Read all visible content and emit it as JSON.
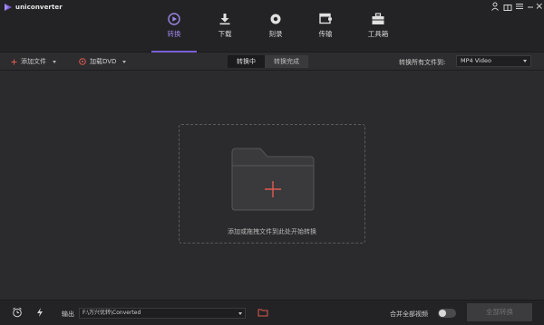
{
  "app": {
    "name": "uniconverter",
    "brand_color": "#7b5fd6"
  },
  "nav": {
    "tabs": [
      {
        "label": "转换",
        "icon": "convert-icon",
        "active": true
      },
      {
        "label": "下载",
        "icon": "download-icon",
        "active": false
      },
      {
        "label": "刻录",
        "icon": "burn-disc-icon",
        "active": false
      },
      {
        "label": "传输",
        "icon": "transfer-icon",
        "active": false
      },
      {
        "label": "工具箱",
        "icon": "toolbox-icon",
        "active": false
      }
    ]
  },
  "window_controls": [
    "user-icon",
    "gift-icon",
    "menu-icon",
    "minimize-icon",
    "close-icon"
  ],
  "toolbar": {
    "add_files": "添加文件",
    "load_dvd": "加载DVD",
    "seg_converting": "转换中",
    "seg_finished": "转换完成",
    "convert_all_to": "转换所有文件到:",
    "format_value": "MP4 Video"
  },
  "dropzone": {
    "text": "添加或拖拽文件到此处开始转换"
  },
  "bottom": {
    "output_label": "输出",
    "output_path": "F:\\万兴优转\\Converted",
    "merge_label": "合并全部视频",
    "merge_on": false,
    "convert_all_button": "全部转换"
  }
}
